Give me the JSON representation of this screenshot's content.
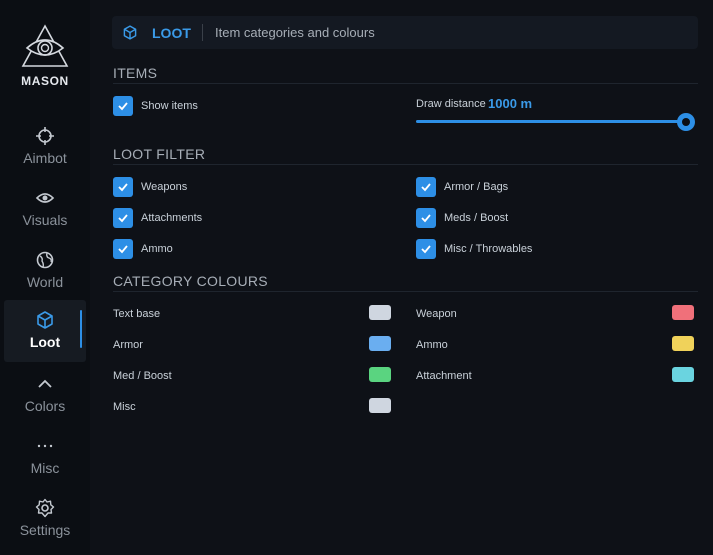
{
  "sidebar": {
    "logo_text": "MASON",
    "items": [
      {
        "label": "Aimbot",
        "icon": "crosshair-icon"
      },
      {
        "label": "Visuals",
        "icon": "eye-icon"
      },
      {
        "label": "World",
        "icon": "globe-icon"
      },
      {
        "label": "Loot",
        "icon": "cube-icon",
        "active": true
      },
      {
        "label": "Colors",
        "icon": "chevron-up-icon"
      },
      {
        "label": "Misc",
        "icon": "ellipsis-icon"
      },
      {
        "label": "Settings",
        "icon": "gear-icon"
      }
    ]
  },
  "header": {
    "tag": "LOOT",
    "description": "Item categories and colours"
  },
  "items": {
    "title": "ITEMS",
    "show_items": {
      "label": "Show items",
      "checked": true
    },
    "draw_distance": {
      "label": "Draw distance",
      "value": "1000 m",
      "fraction": 1.0
    }
  },
  "loot_filter": {
    "title": "LOOT FILTER",
    "options": [
      {
        "label": "Weapons",
        "checked": true
      },
      {
        "label": "Armor / Bags",
        "checked": true
      },
      {
        "label": "Attachments",
        "checked": true
      },
      {
        "label": "Meds / Boost",
        "checked": true
      },
      {
        "label": "Ammo",
        "checked": true
      },
      {
        "label": "Misc / Throwables",
        "checked": true
      }
    ]
  },
  "category_colours": {
    "title": "CATEGORY COLOURS",
    "entries": [
      {
        "label": "Text base",
        "color": "#cfd6e0"
      },
      {
        "label": "Weapon",
        "color": "#f0707a"
      },
      {
        "label": "Armor",
        "color": "#6aaef0"
      },
      {
        "label": "Ammo",
        "color": "#f0d25a"
      },
      {
        "label": "Med / Boost",
        "color": "#5ad480"
      },
      {
        "label": "Attachment",
        "color": "#6ad4e0"
      },
      {
        "label": "Misc",
        "color": "#cfd6e0"
      }
    ]
  },
  "colors": {
    "accent": "#2d8fe6",
    "background": "#0e1117",
    "sidebar": "#0b0e13"
  }
}
